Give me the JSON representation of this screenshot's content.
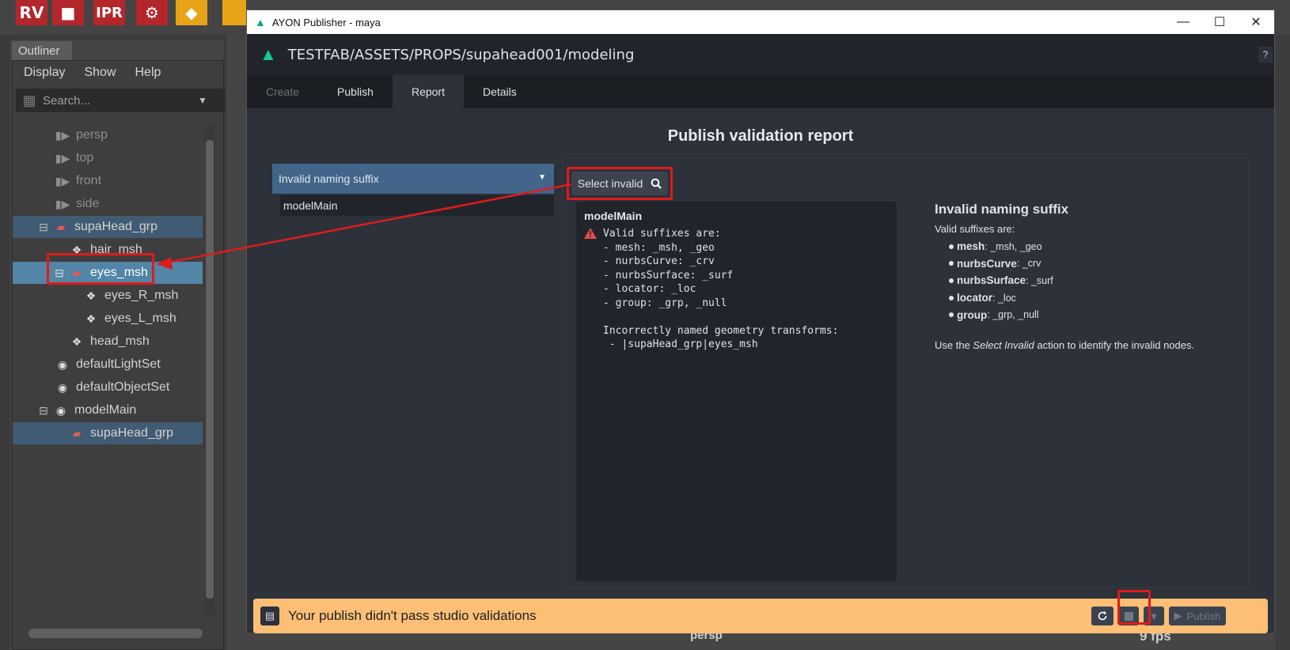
{
  "maya": {
    "shelf": {
      "rv_label": "RV",
      "ipr_label": "IPR"
    },
    "outliner": {
      "title": "Outliner",
      "menu": [
        "Display",
        "Show",
        "Help"
      ],
      "search_placeholder": "Search...",
      "items": [
        {
          "label": "persp",
          "icon": "camera-icon"
        },
        {
          "label": "top",
          "icon": "camera-icon"
        },
        {
          "label": "front",
          "icon": "camera-icon"
        },
        {
          "label": "side",
          "icon": "camera-icon"
        },
        {
          "label": "supaHead_grp",
          "icon": "transform-icon"
        },
        {
          "label": "hair_msh",
          "icon": "mesh-icon"
        },
        {
          "label": "eyes_msh",
          "icon": "transform-icon"
        },
        {
          "label": "eyes_R_msh",
          "icon": "mesh-icon"
        },
        {
          "label": "eyes_L_msh",
          "icon": "mesh-icon"
        },
        {
          "label": "head_msh",
          "icon": "mesh-icon"
        },
        {
          "label": "defaultLightSet",
          "icon": "set-icon"
        },
        {
          "label": "defaultObjectSet",
          "icon": "set-icon"
        },
        {
          "label": "modelMain",
          "icon": "set-icon"
        },
        {
          "label": "supaHead_grp",
          "icon": "transform-icon"
        }
      ]
    },
    "viewport": {
      "camera_label": "persp",
      "fps": "9 fps"
    }
  },
  "ayon": {
    "window_title": "AYON Publisher - maya",
    "context_path": "TESTFAB/ASSETS/PROPS/supahead001/modeling",
    "help_label": "?",
    "tabs": [
      {
        "label": "Create",
        "state": "disabled"
      },
      {
        "label": "Publish",
        "state": "normal"
      },
      {
        "label": "Report",
        "state": "active"
      },
      {
        "label": "Details",
        "state": "normal"
      }
    ],
    "report": {
      "title": "Publish validation report",
      "error_group": "Invalid naming suffix",
      "instance": "modelMain",
      "select_invalid_label": "Select invalid",
      "log_title": "modelMain",
      "log_text": "Valid suffixes are:\n- mesh: _msh, _geo\n- nurbsCurve: _crv\n- nurbsSurface: _surf\n- locator: _loc\n- group: _grp, _null\n\nIncorrectly named geometry transforms:\n - |supaHead_grp|eyes_msh",
      "description": {
        "title": "Invalid naming suffix",
        "intro": "Valid suffixes are:",
        "items": [
          {
            "type": "mesh",
            "suffixes": ": _msh, _geo"
          },
          {
            "type": "nurbsCurve",
            "suffixes": ": _crv"
          },
          {
            "type": "nurbsSurface",
            "suffixes": ": _surf"
          },
          {
            "type": "locator",
            "suffixes": ": _loc"
          },
          {
            "type": "group",
            "suffixes": ": _grp, _null"
          }
        ],
        "footer_pre": "Use the ",
        "footer_em": "Select Invalid",
        "footer_post": " action to identify the invalid nodes."
      }
    },
    "status": {
      "message": "Your publish didn't pass studio validations",
      "publish_label": "Publish"
    },
    "colors": {
      "status_bar": "#fcbf75",
      "accent": "#14c99a",
      "annotation": "#e01b1b",
      "selection": "#5285a6"
    }
  }
}
